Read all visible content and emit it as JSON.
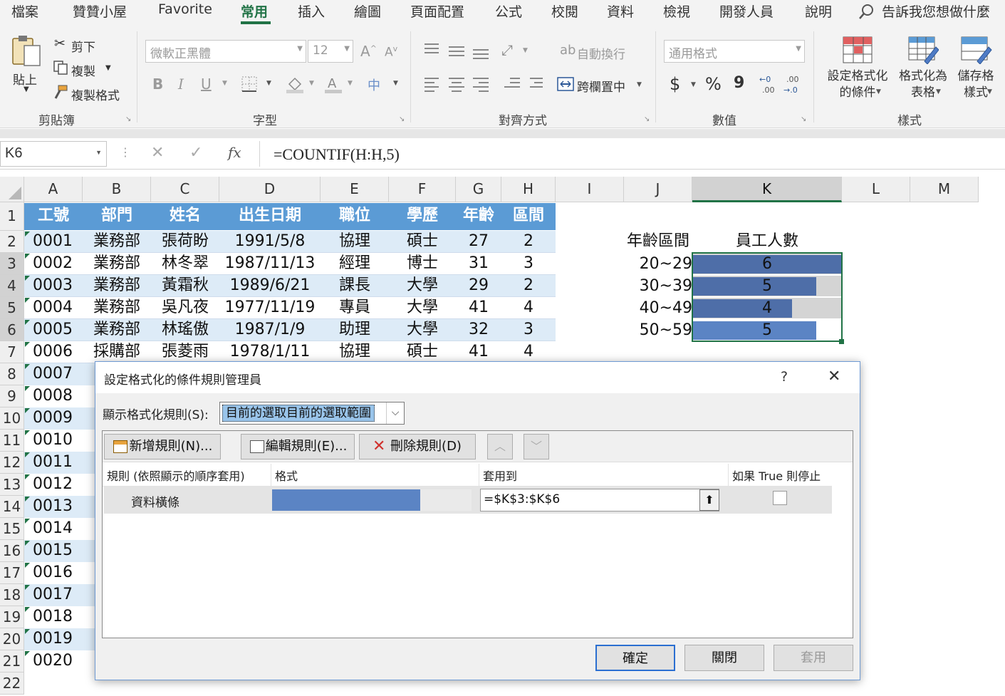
{
  "menu": {
    "tabs": [
      "檔案",
      "贊贊小屋",
      "Favorite",
      "常用",
      "插入",
      "繪圖",
      "頁面配置",
      "公式",
      "校閱",
      "資料",
      "檢視",
      "開發人員",
      "說明"
    ],
    "active": "常用",
    "tell_me": "告訴我您想做什麼"
  },
  "ribbon": {
    "clipboard": {
      "paste": "貼上",
      "cut": "剪下",
      "copy": "複製",
      "format_painter": "複製格式",
      "group": "剪貼簿"
    },
    "font": {
      "name": "微軟正黑體",
      "size": "12",
      "bold": "B",
      "italic": "I",
      "underline": "U",
      "phonetic": "中",
      "group": "字型"
    },
    "align": {
      "wrap": "自動換行",
      "merge": "跨欄置中",
      "group": "對齊方式"
    },
    "number": {
      "format": "通用格式",
      "currency": "$",
      "percent": "%",
      "comma": "9",
      "inc_decimal": ".00",
      "dec_decimal": ".00",
      "group": "數值"
    },
    "styles": {
      "cond": "設定格式化的條件",
      "table": "格式化為表格",
      "cell": "儲存格樣式",
      "group": "樣式"
    }
  },
  "formula_bar": {
    "name_box": "K6",
    "formula": "=COUNTIF(H:H,5)",
    "fx": "fx"
  },
  "columns": [
    "A",
    "B",
    "C",
    "D",
    "E",
    "F",
    "G",
    "H",
    "I",
    "J",
    "K",
    "L",
    "M"
  ],
  "rows": [
    "1",
    "2",
    "3",
    "4",
    "5",
    "6",
    "7",
    "8",
    "9",
    "10",
    "11",
    "12",
    "13",
    "14",
    "15",
    "16",
    "17",
    "18",
    "19",
    "20",
    "21",
    "22"
  ],
  "table": {
    "headers": [
      "工號",
      "部門",
      "姓名",
      "出生日期",
      "職位",
      "學歷",
      "年齡",
      "區間"
    ],
    "rows": [
      [
        "0001",
        "業務部",
        "張荷盼",
        "1991/5/8",
        "協理",
        "碩士",
        "27",
        "2"
      ],
      [
        "0002",
        "業務部",
        "林冬翠",
        "1987/11/13",
        "經理",
        "博士",
        "31",
        "3"
      ],
      [
        "0003",
        "業務部",
        "黃霜秋",
        "1989/6/21",
        "課長",
        "大學",
        "29",
        "2"
      ],
      [
        "0004",
        "業務部",
        "吳凡夜",
        "1977/11/19",
        "專員",
        "大學",
        "41",
        "4"
      ],
      [
        "0005",
        "業務部",
        "林瑤傲",
        "1987/1/9",
        "助理",
        "大學",
        "32",
        "3"
      ],
      [
        "0006",
        "採購部",
        "張菱雨",
        "1978/1/11",
        "協理",
        "碩士",
        "41",
        "4"
      ]
    ],
    "ids_more": [
      "0007",
      "0008",
      "0009",
      "0010",
      "0011",
      "0012",
      "0013",
      "0014",
      "0015",
      "0016",
      "0017",
      "0018",
      "0019",
      "0020"
    ]
  },
  "summary": {
    "col_j": "年齡區間",
    "col_k": "員工人數",
    "rows": [
      {
        "range": "20~29",
        "count": "6",
        "bar": 1.0
      },
      {
        "range": "30~39",
        "count": "5",
        "bar": 0.83
      },
      {
        "range": "40~49",
        "count": "4",
        "bar": 0.67
      },
      {
        "range": "50~59",
        "count": "5",
        "bar": 0.83
      }
    ]
  },
  "dialog": {
    "title": "設定格式化的條件規則管理員",
    "help": "?",
    "close": "✕",
    "show_label": "顯示格式化規則(S):",
    "show_value": "目前的選取目前的選取範圍",
    "new_rule": "新增規則(N)...",
    "edit_rule": "編輯規則(E)...",
    "delete_rule": "刪除規則(D)",
    "col_rule": "規則 (依照顯示的順序套用)",
    "col_format": "格式",
    "col_applies": "套用到",
    "col_stop": "如果 True 則停止",
    "rule_name": "資料橫條",
    "applies_value": "=$K$3:$K$6",
    "ok": "確定",
    "close_btn": "關閉",
    "apply": "套用"
  },
  "colors": {
    "accent": "#217346",
    "header_blue": "#5b9bd5",
    "band": "#ddebf7",
    "bar": "#4e6ea8",
    "bar_light": "#5b84c4"
  }
}
